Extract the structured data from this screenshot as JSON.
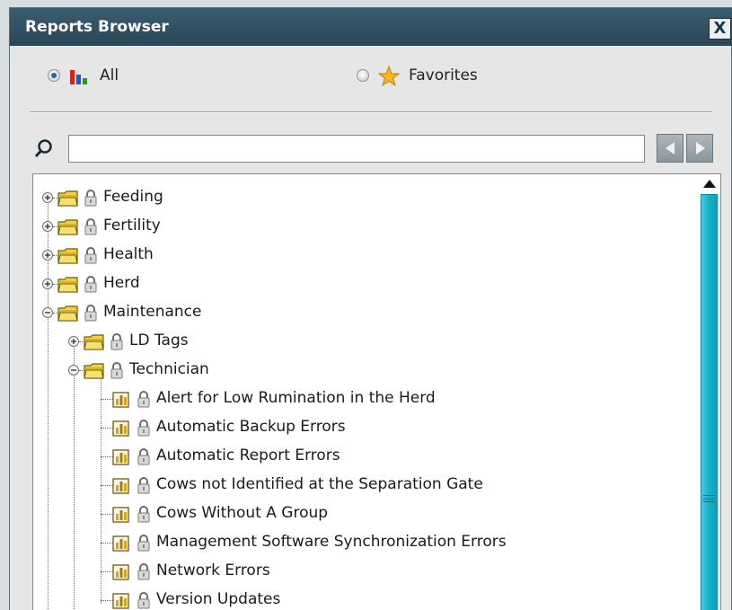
{
  "window": {
    "title": "Reports Browser",
    "close_label": "X"
  },
  "filter": {
    "all_label": "All",
    "favorites_label": "Favorites",
    "selected": "All"
  },
  "search": {
    "value": "",
    "placeholder": ""
  },
  "tree": {
    "folders": [
      {
        "label": "Feeding",
        "state": "collapsed"
      },
      {
        "label": "Fertility",
        "state": "collapsed"
      },
      {
        "label": "Health",
        "state": "collapsed"
      },
      {
        "label": "Herd",
        "state": "collapsed"
      },
      {
        "label": "Maintenance",
        "state": "expanded"
      }
    ],
    "maintenance_children": [
      {
        "label": "LD Tags",
        "state": "collapsed"
      },
      {
        "label": "Technician",
        "state": "expanded"
      }
    ],
    "technician_reports": [
      "Alert for Low Rumination in the Herd",
      "Automatic Backup Errors",
      "Automatic Report Errors",
      "Cows not Identified at the Separation Gate",
      "Cows Without A Group",
      "Management Software Synchronization Errors",
      "Network Errors",
      "Version Updates"
    ]
  },
  "colors": {
    "titlebar": "#2f4d5e",
    "scrollbar": "#18b3cc",
    "folder": "#f4d23c",
    "window_bg": "#e6e6e6"
  }
}
